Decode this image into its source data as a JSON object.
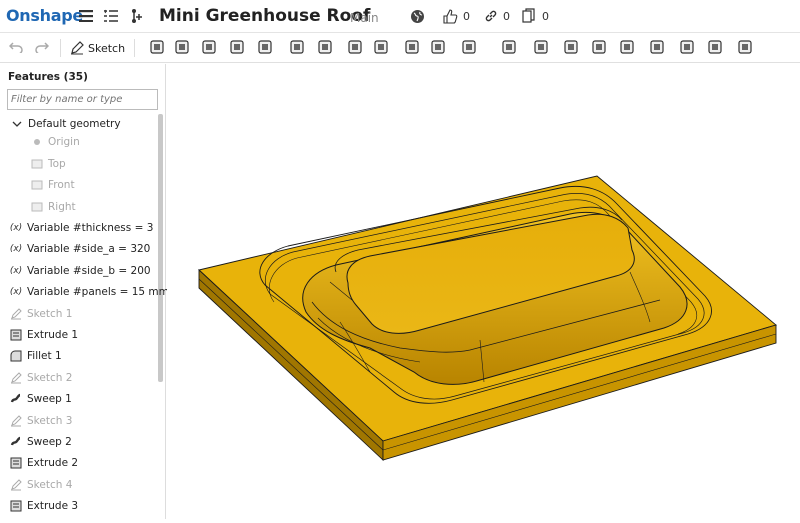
{
  "app": {
    "logo": "Onshape",
    "document_title": "Mini Greenhouse Roof",
    "branch": "Main",
    "likes_count": "0",
    "links_count": "0",
    "copies_count": "0"
  },
  "toolbar": {
    "sketch_label": "Sketch",
    "tools": [
      "undo-icon",
      "redo-icon",
      "extrude-icon",
      "revolve-icon",
      "sweep-icon",
      "loft-icon",
      "thicken-icon",
      "fillet-icon",
      "chamfer-icon",
      "draft-icon",
      "shell-icon",
      "hole-icon",
      "pattern-icon",
      "mirror-icon",
      "boolean-icon",
      "split-icon",
      "transform-icon",
      "delete-part-icon",
      "sheet-metal-icon",
      "modify-fillet-icon",
      "move-face-icon",
      "replace-face-icon",
      "offset-surface-icon"
    ]
  },
  "features_panel": {
    "title": "Features (35)",
    "filter_placeholder": "Filter by name or type",
    "default_geometry": "Default geometry",
    "geometry_items": [
      "Origin",
      "Top",
      "Front",
      "Right"
    ],
    "items": [
      {
        "label": "Variable #thickness = 3",
        "type": "variable",
        "dim": false
      },
      {
        "label": "Variable #side_a = 320",
        "type": "variable",
        "dim": false
      },
      {
        "label": "Variable #side_b = 200",
        "type": "variable",
        "dim": false
      },
      {
        "label": "Variable #panels = 15 mm",
        "type": "variable",
        "dim": false
      },
      {
        "label": "Sketch 1",
        "type": "sketch",
        "dim": true
      },
      {
        "label": "Extrude 1",
        "type": "extrude",
        "dim": false
      },
      {
        "label": "Fillet 1",
        "type": "fillet",
        "dim": false
      },
      {
        "label": "Sketch 2",
        "type": "sketch",
        "dim": true
      },
      {
        "label": "Sweep 1",
        "type": "sweep",
        "dim": false
      },
      {
        "label": "Sketch 3",
        "type": "sketch",
        "dim": true
      },
      {
        "label": "Sweep 2",
        "type": "sweep",
        "dim": false
      },
      {
        "label": "Extrude 2",
        "type": "extrude",
        "dim": false
      },
      {
        "label": "Sketch 4",
        "type": "sketch",
        "dim": true
      },
      {
        "label": "Extrude 3",
        "type": "extrude",
        "dim": false
      }
    ]
  },
  "colors": {
    "brand": "#1f67b3",
    "part_face": "#e8b30a",
    "part_edge": "#1a1a1a"
  }
}
